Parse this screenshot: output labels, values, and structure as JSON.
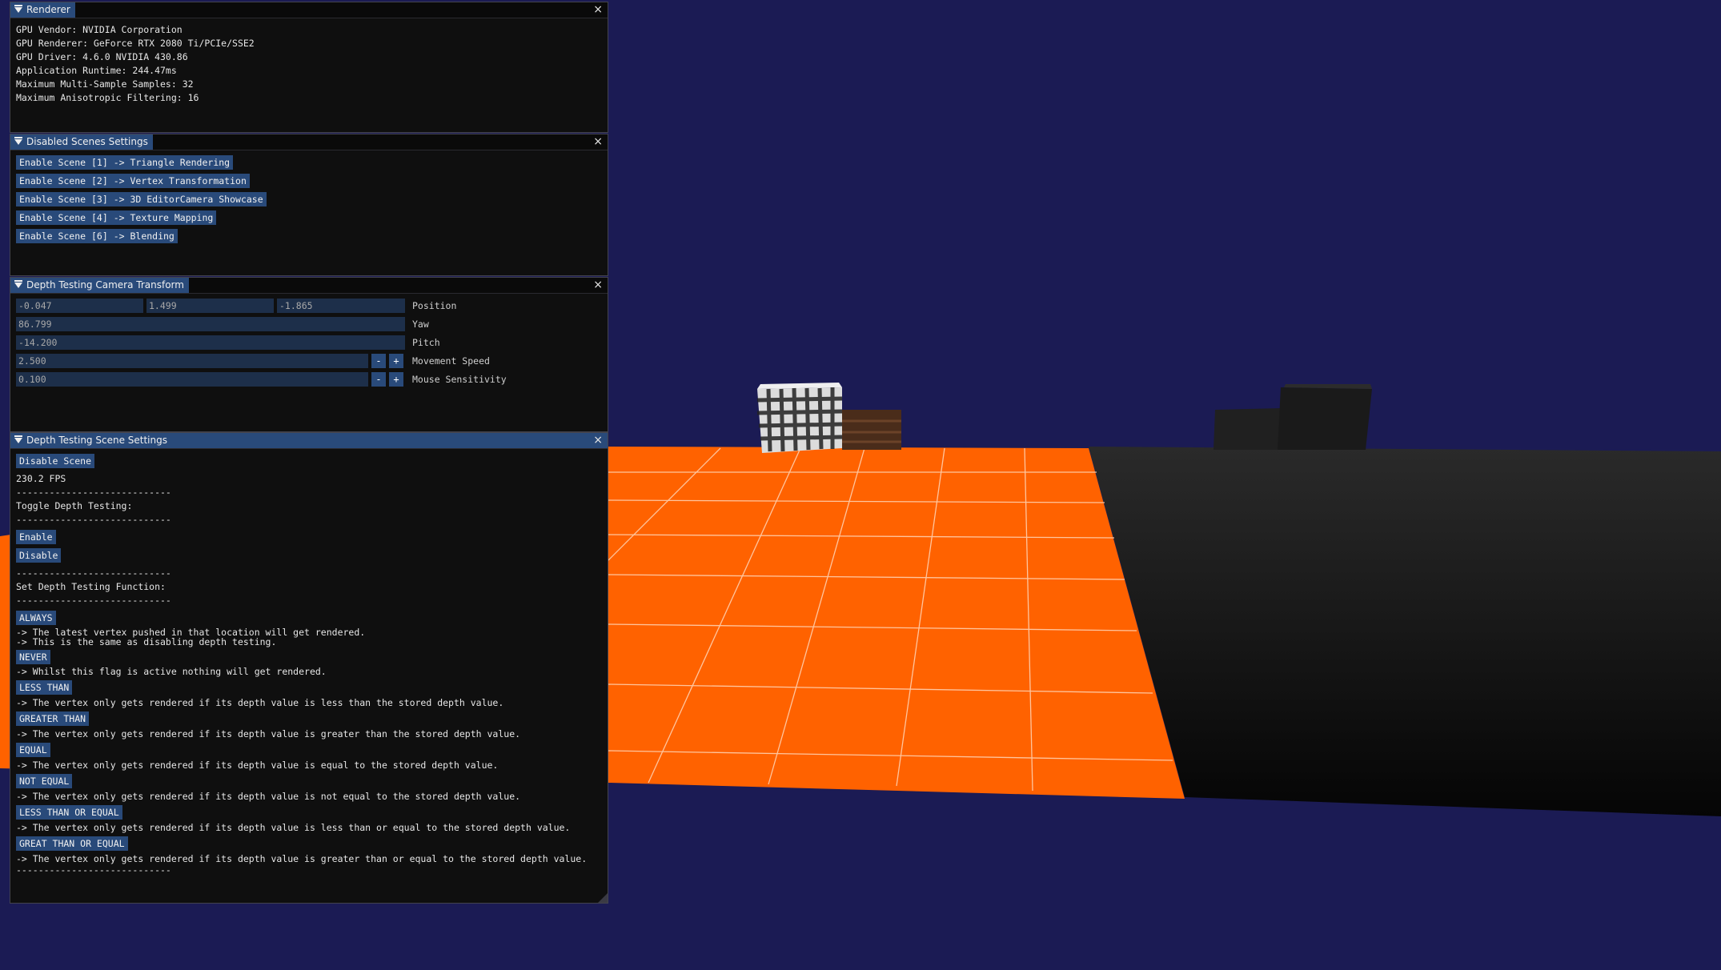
{
  "renderer": {
    "title": "Renderer",
    "close": "×",
    "lines": [
      "GPU Vendor: NVIDIA Corporation",
      "GPU Renderer: GeForce RTX 2080 Ti/PCIe/SSE2",
      "GPU Driver: 4.6.0 NVIDIA 430.86",
      "Application Runtime: 244.47ms",
      "Maximum Multi-Sample Samples: 32",
      "Maximum Anisotropic Filtering: 16"
    ]
  },
  "disabled_scenes": {
    "title": "Disabled Scenes Settings",
    "close": "×",
    "buttons": [
      "Enable Scene [1] -> Triangle Rendering",
      "Enable Scene [2] -> Vertex Transformation",
      "Enable Scene [3] -> 3D EditorCamera Showcase",
      "Enable Scene [4] -> Texture Mapping",
      "Enable Scene [6] -> Blending"
    ]
  },
  "camera_transform": {
    "title": "Depth Testing Camera Transform",
    "close": "×",
    "position": {
      "x": "-0.047",
      "y": "1.499",
      "z": "-1.865",
      "label": "Position"
    },
    "yaw": {
      "value": "86.799",
      "label": "Yaw"
    },
    "pitch": {
      "value": "-14.200",
      "label": "Pitch"
    },
    "movement_speed": {
      "value": "2.500",
      "label": "Movement Speed",
      "minus": "-",
      "plus": "+"
    },
    "mouse_sensitivity": {
      "value": "0.100",
      "label": "Mouse Sensitivity",
      "minus": "-",
      "plus": "+"
    }
  },
  "scene_settings": {
    "title": "Depth Testing Scene Settings",
    "close": "×",
    "disable_scene": "Disable Scene",
    "fps": "230.2 FPS",
    "separator": "----------------------------",
    "toggle_heading": "Toggle Depth Testing:",
    "enable": "Enable",
    "disable": "Disable",
    "function_heading": "Set Depth Testing Function:",
    "functions": [
      {
        "label": "ALWAYS",
        "desc": "-> The latest vertex pushed in that location will get rendered.\n-> This is the same as disabling depth testing."
      },
      {
        "label": "NEVER",
        "desc": "-> Whilst this flag is active nothing will get rendered."
      },
      {
        "label": "LESS THAN",
        "desc": "-> The vertex only gets rendered if its depth value is less than the stored depth value."
      },
      {
        "label": "GREATER THAN",
        "desc": "-> The vertex only gets rendered if its depth value is greater than the stored depth value."
      },
      {
        "label": "EQUAL",
        "desc": "-> The vertex only gets rendered if its depth value is equal to the stored depth value."
      },
      {
        "label": "NOT EQUAL",
        "desc": "-> The vertex only gets rendered if its depth value is not equal to the stored depth value."
      },
      {
        "label": "LESS THAN OR EQUAL",
        "desc": "-> The vertex only gets rendered if its depth value is less than or equal to the stored depth value."
      },
      {
        "label": "GREAT THAN OR EQUAL",
        "desc": "-> The vertex only gets rendered if its depth value is greater than or equal to the stored depth value."
      }
    ]
  },
  "colors": {
    "background": "#1b1b54",
    "floor": "#ff6200",
    "button": "#294a7a",
    "panel": "#0f0f0f"
  }
}
